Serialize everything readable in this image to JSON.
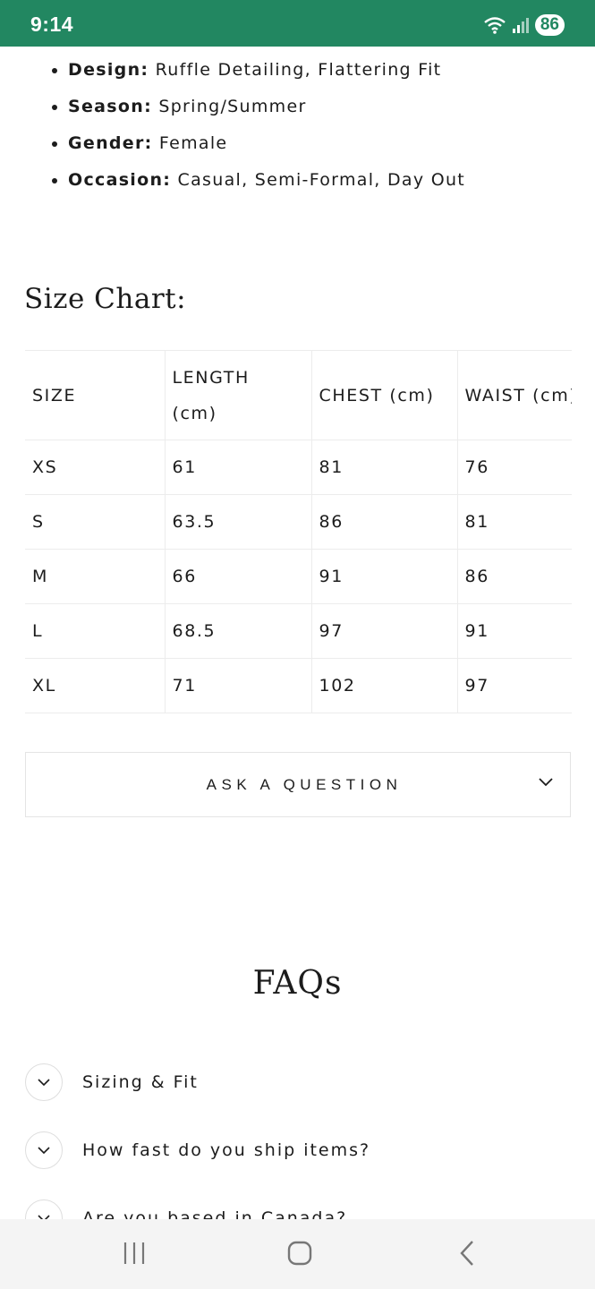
{
  "status_bar": {
    "time": "9:14",
    "battery": "86"
  },
  "specs": [
    {
      "label": "Design:",
      "value": "Ruffle Detailing, Flattering Fit"
    },
    {
      "label": "Season:",
      "value": "Spring/Summer"
    },
    {
      "label": "Gender:",
      "value": "Female"
    },
    {
      "label": "Occasion:",
      "value": "Casual, Semi-Formal, Day Out"
    }
  ],
  "size_chart": {
    "title": "Size Chart:",
    "headers": [
      "SIZE",
      "LENGTH (cm)",
      "CHEST (cm)",
      "WAIST (cm)"
    ],
    "rows": [
      [
        "XS",
        "61",
        "81",
        "76"
      ],
      [
        "S",
        "63.5",
        "86",
        "81"
      ],
      [
        "M",
        "66",
        "91",
        "86"
      ],
      [
        "L",
        "68.5",
        "97",
        "91"
      ],
      [
        "XL",
        "71",
        "102",
        "97"
      ]
    ]
  },
  "ask_question": {
    "label": "ASK A QUESTION"
  },
  "faqs": {
    "title": "FAQs",
    "items": [
      "Sizing & Fit",
      "How fast do you ship items?",
      "Are you based in Canada?"
    ]
  },
  "icons": {
    "ask_toggle": "chevron-down-icon",
    "faq_toggle": "chevron-down-icon",
    "nav_recents": "recents-icon",
    "nav_home": "home-icon",
    "nav_back": "back-icon"
  },
  "colors": {
    "status_bar": "#228761",
    "text": "#1c1c1c",
    "border": "#ececec"
  }
}
